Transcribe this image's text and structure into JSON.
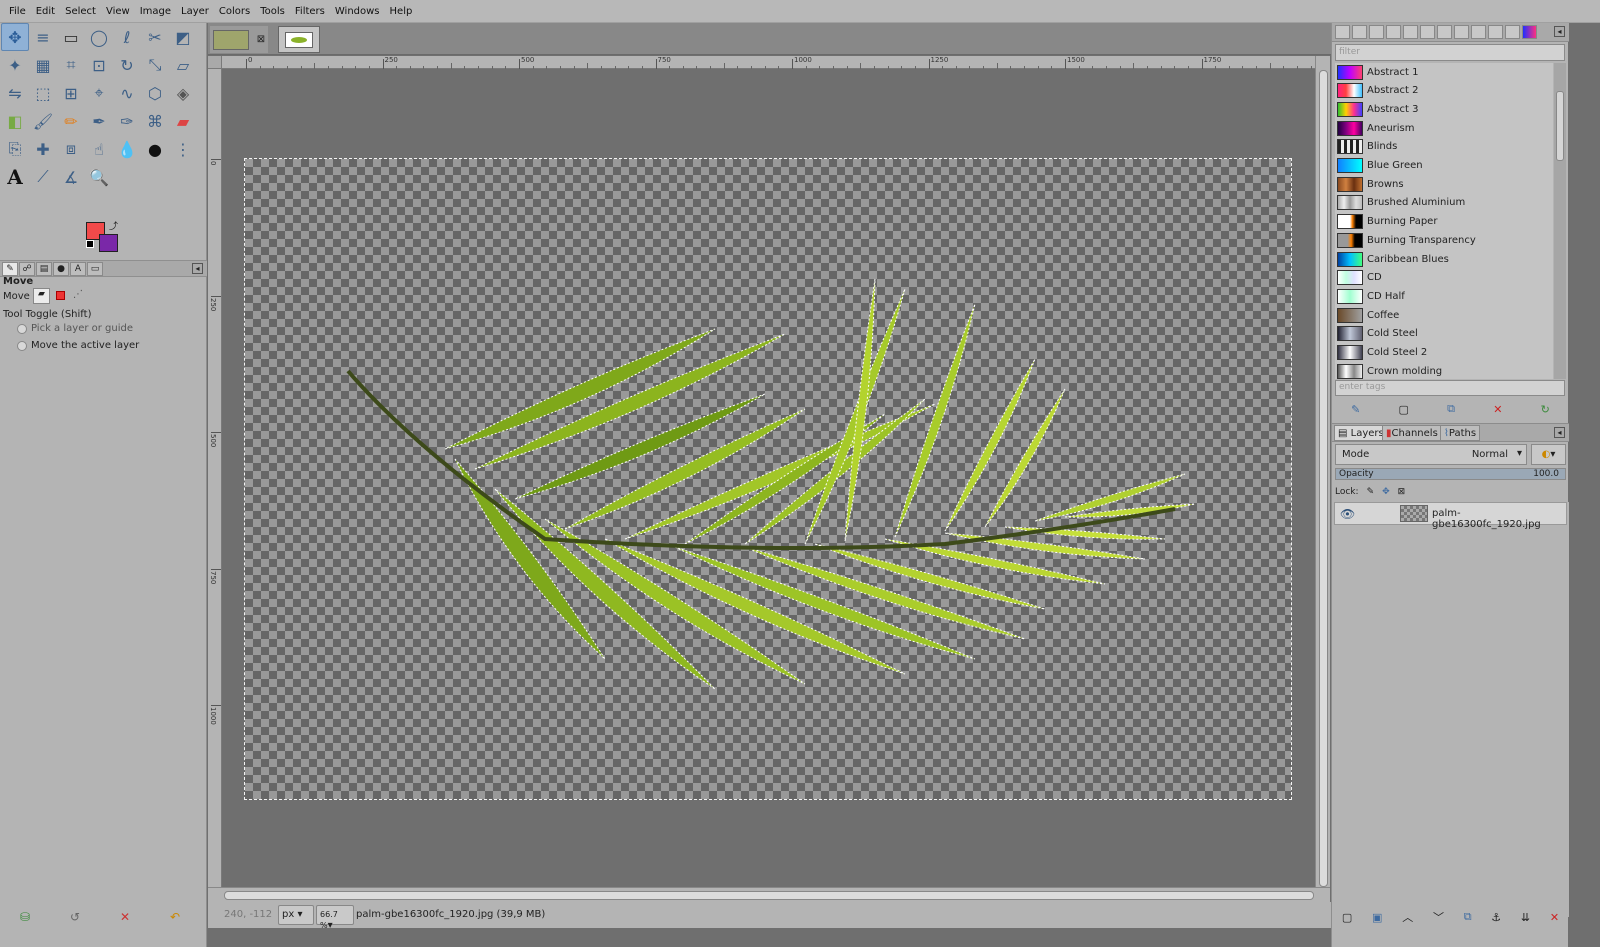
{
  "menu": [
    "File",
    "Edit",
    "Select",
    "View",
    "Image",
    "Layer",
    "Colors",
    "Tools",
    "Filters",
    "Windows",
    "Help"
  ],
  "colors": {
    "foreground": "#f24a4a",
    "background": "#7a28a8",
    "selection_outline": "#ffffff"
  },
  "tool_icons": [
    [
      "move-tool-icon",
      "align-tool-icon",
      "rect-select-icon",
      "ellipse-select-icon",
      "free-select-icon",
      "scissors-select-icon",
      "foreground-select-icon"
    ],
    [
      "fuzzy-select-icon",
      "color-select-icon",
      "crop-tool-icon",
      "unified-transform-icon",
      "rotate-tool-icon",
      "scale-tool-icon",
      "shear-tool-icon"
    ],
    [
      "flip-tool-icon",
      "perspective-tool-icon",
      "3d-transform-icon",
      "handle-transform-icon",
      "warp-transform-icon",
      "cage-transform-icon",
      "bucket-fill-icon"
    ],
    [
      "gradient-tool-icon",
      "paintbrush-icon",
      "pencil-icon",
      "airbrush-icon",
      "ink-icon",
      "mypaint-brush-icon",
      "eraser-icon"
    ],
    [
      "clone-tool-icon",
      "heal-tool-icon",
      "perspective-clone-icon",
      "smudge-tool-icon",
      "blur-sharpen-icon",
      "dodge-burn-icon",
      "paths-tool-icon"
    ],
    [
      "text-tool-icon",
      "color-picker-icon",
      "measure-tool-icon",
      "zoom-tool-icon"
    ]
  ],
  "tool_options": {
    "title": "Move",
    "move_label": "Move",
    "toggle_label": "Tool Toggle  (Shift)",
    "option1": "Pick a layer or guide",
    "option2": "Move the active layer"
  },
  "ruler": {
    "h_labels": [
      "0",
      "250",
      "500",
      "750",
      "1000",
      "1250",
      "1500",
      "1750"
    ],
    "v_labels": [
      "0",
      "250",
      "500",
      "750",
      "1000"
    ]
  },
  "status": {
    "coords": "240, -112",
    "unit": "px",
    "zoom": "66.7 %",
    "message": "palm-gbe16300fc_1920.jpg (39,9 MB)"
  },
  "gradients": {
    "filter_placeholder": "filter",
    "tags_placeholder": "enter tags",
    "items": [
      {
        "name": "Abstract 1",
        "c": "linear-gradient(90deg,#2030ff,#c000ff,#ff4070)"
      },
      {
        "name": "Abstract 2",
        "c": "linear-gradient(90deg,#ff2080,#ff4040,#ffffff,#40c0ff)"
      },
      {
        "name": "Abstract 3",
        "c": "linear-gradient(90deg,#30c030,#ffd000,#ff3090,#4040ff)"
      },
      {
        "name": "Aneurism",
        "c": "linear-gradient(90deg,#200040,#800080,#ff00a0,#400060)"
      },
      {
        "name": "Blinds",
        "c": "repeating-linear-gradient(90deg,#222 0 3px,#eee 3px 6px)"
      },
      {
        "name": "Blue Green",
        "c": "linear-gradient(90deg,#1080ff,#00ffff)"
      },
      {
        "name": "Browns",
        "c": "linear-gradient(90deg,#8a4a20,#d08040,#6a3010,#c07030)"
      },
      {
        "name": "Brushed Aluminium",
        "c": "linear-gradient(90deg,#aaa,#eee,#999,#ddd,#bbb)"
      },
      {
        "name": "Burning Paper",
        "c": "linear-gradient(90deg,#ffffff 50%,#ff8000 60%,#000 75%)"
      },
      {
        "name": "Burning Transparency",
        "c": "linear-gradient(90deg,#999 40%,#ff8000 55%,#000 70%)"
      },
      {
        "name": "Caribbean Blues",
        "c": "linear-gradient(90deg,#0040a0,#00c0ff,#40ff80)"
      },
      {
        "name": "CD",
        "c": "linear-gradient(90deg,#fff,#c0ffe0,#e0e0ff,#fff)"
      },
      {
        "name": "CD Half",
        "c": "linear-gradient(90deg,#fff,#a0ffd0,#fff)"
      },
      {
        "name": "Coffee",
        "c": "linear-gradient(90deg,#6a4a2a,#a0a0a0)"
      },
      {
        "name": "Cold Steel",
        "c": "linear-gradient(90deg,#202030,#c0c8d8,#606070)"
      },
      {
        "name": "Cold Steel 2",
        "c": "linear-gradient(90deg,#303040,#ffffff,#404050)"
      },
      {
        "name": "Crown molding",
        "c": "linear-gradient(90deg,#555,#fff,#888,#eee)"
      }
    ]
  },
  "layers_panel": {
    "tabs": [
      "Layers",
      "Channels",
      "Paths"
    ],
    "mode_label": "Mode",
    "mode_value": "Normal",
    "opacity_label": "Opacity",
    "opacity_value": "100.0",
    "opacity_fraction": 1.0,
    "lock_label": "Lock:",
    "layer_name": "palm-gbe16300fc_1920.jpg"
  }
}
